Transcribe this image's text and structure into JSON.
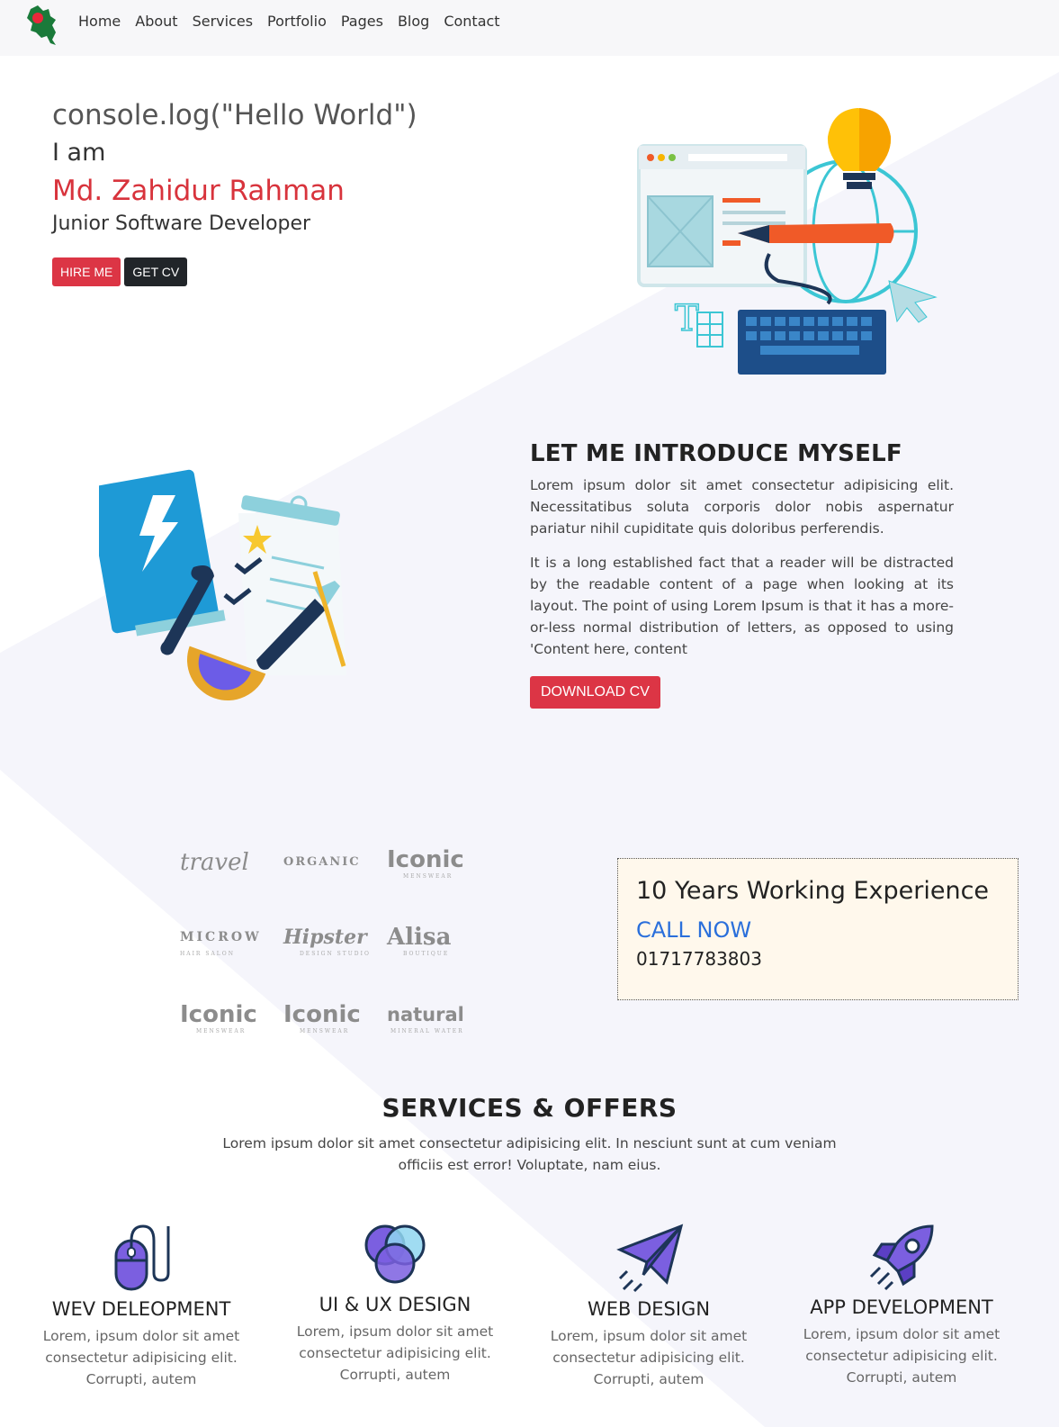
{
  "nav": {
    "logo_icon": "bangladesh-map-logo",
    "links": [
      "Home",
      "About",
      "Services",
      "Portfolio",
      "Pages",
      "Blog",
      "Contact"
    ]
  },
  "hero": {
    "code_line": "console.log(\"Hello World\")",
    "iam": "I am",
    "name": "Md. Zahidur Rahman",
    "role": "Junior Software Developer",
    "hire_label": "HIRE ME",
    "cv_label": "GET CV",
    "illustration_icon": "web-development-illustration"
  },
  "intro": {
    "title": "LET ME INTRODUCE MYSELF",
    "p1": "Lorem ipsum dolor sit amet consectetur adipisicing elit. Necessitatibus soluta corporis dolor nobis aspernatur pariatur nihil cupiditate quis doloribus perferendis.",
    "p2": "It is a long established fact that a reader will be distracted by the readable content of a page when looking at its layout. The point of using Lorem Ipsum is that it has a more-or-less normal distribution of letters, as opposed to using 'Content here, content",
    "download_label": "DOWNLOAD CV",
    "illustration_icon": "tools-checklist-illustration"
  },
  "brands": [
    {
      "big": "travel",
      "small": ""
    },
    {
      "big": "ORGANIC",
      "small": ""
    },
    {
      "big": "Iconic",
      "small": "MENSWEAR"
    },
    {
      "big": "MICROW",
      "small": "HAIR SALON"
    },
    {
      "big": "Hipster",
      "small": "DESIGN STUDIO"
    },
    {
      "big": "Alisa",
      "small": "BOUTIQUE"
    },
    {
      "big": "Iconic",
      "small": "MENSWEAR"
    },
    {
      "big": "Iconic",
      "small": "MENSWEAR"
    },
    {
      "big": "natural",
      "small": "MINERAL WATER"
    }
  ],
  "experience": {
    "title": "10 Years Working Experience",
    "call_label": "CALL NOW",
    "phone": "01717783803"
  },
  "services": {
    "title": "SERVICES & OFFERS",
    "subtitle": "Lorem ipsum dolor sit amet consectetur adipisicing elit. In nesciunt sunt at cum veniam officiis est error! Voluptate, nam eius.",
    "items": [
      {
        "icon": "mouse-icon",
        "title": "WEV DELEOPMENT",
        "text": "Lorem, ipsum dolor sit amet consectetur adipisicing elit. Corrupti, autem"
      },
      {
        "icon": "venn-circles-icon",
        "title": "UI & UX DESIGN",
        "text": "Lorem, ipsum dolor sit amet consectetur adipisicing elit. Corrupti, autem"
      },
      {
        "icon": "paper-plane-icon",
        "title": "WEB DESIGN",
        "text": "Lorem, ipsum dolor sit amet consectetur adipisicing elit. Corrupti, autem"
      },
      {
        "icon": "rocket-icon",
        "title": "APP DEVELOPMENT",
        "text": "Lorem, ipsum dolor sit amet consectetur adipisicing elit. Corrupti, autem"
      }
    ]
  },
  "colors": {
    "accent_red": "#dc3545",
    "name_red": "#d8333c",
    "dark": "#212529",
    "link_blue": "#2a6fdb",
    "exp_bg": "#fff8ec"
  }
}
